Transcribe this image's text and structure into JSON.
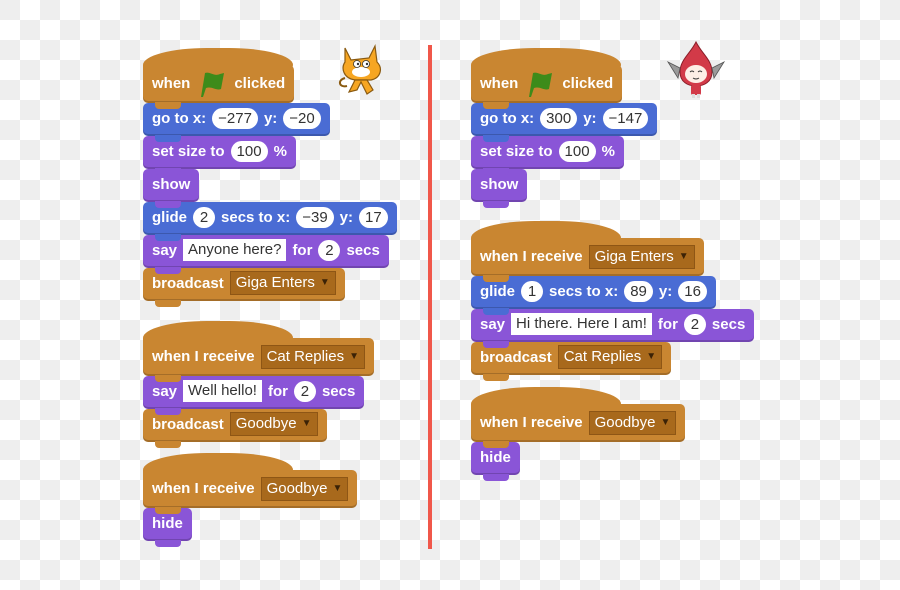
{
  "colors": {
    "events": "#c98631",
    "motion": "#4a6cd4",
    "looks": "#8a55d7",
    "divider": "#f0574a",
    "flag": "#3d8b1a"
  },
  "left": {
    "sprite": "cat-sprite",
    "scripts": [
      {
        "hat": {
          "prefix": "when",
          "icon": "green-flag-icon",
          "suffix": "clicked"
        },
        "blocks": [
          {
            "type": "goto",
            "label1": "go to x:",
            "x": "−277",
            "label2": "y:",
            "y": "−20"
          },
          {
            "type": "setsize",
            "label1": "set size to",
            "value": "100",
            "label2": "%"
          },
          {
            "type": "show",
            "label": "show"
          },
          {
            "type": "glide",
            "label1": "glide",
            "secs": "2",
            "label2": "secs to x:",
            "x": "−39",
            "label3": "y:",
            "y": "17"
          },
          {
            "type": "say",
            "label1": "say",
            "text": "Anyone here?",
            "label2": "for",
            "secs": "2",
            "label3": "secs"
          },
          {
            "type": "broadcast",
            "label": "broadcast",
            "message": "Giga Enters"
          }
        ]
      },
      {
        "hat": {
          "prefix": "when I receive",
          "message": "Cat Replies"
        },
        "blocks": [
          {
            "type": "say",
            "label1": "say",
            "text": "Well hello!",
            "label2": "for",
            "secs": "2",
            "label3": "secs"
          },
          {
            "type": "broadcast",
            "label": "broadcast",
            "message": "Goodbye"
          }
        ]
      },
      {
        "hat": {
          "prefix": "when I receive",
          "message": "Goodbye"
        },
        "blocks": [
          {
            "type": "hide",
            "label": "hide"
          }
        ]
      }
    ]
  },
  "right": {
    "sprite": "giga-sprite",
    "scripts": [
      {
        "hat": {
          "prefix": "when",
          "icon": "green-flag-icon",
          "suffix": "clicked"
        },
        "blocks": [
          {
            "type": "goto",
            "label1": "go to x:",
            "x": "300",
            "label2": "y:",
            "y": "−147"
          },
          {
            "type": "setsize",
            "label1": "set size to",
            "value": "100",
            "label2": "%"
          },
          {
            "type": "show",
            "label": "show"
          }
        ]
      },
      {
        "hat": {
          "prefix": "when I receive",
          "message": "Giga Enters"
        },
        "blocks": [
          {
            "type": "glide",
            "label1": "glide",
            "secs": "1",
            "label2": "secs to x:",
            "x": "89",
            "label3": "y:",
            "y": "16"
          },
          {
            "type": "say",
            "label1": "say",
            "text": "Hi there. Here I am!",
            "label2": "for",
            "secs": "2",
            "label3": "secs"
          },
          {
            "type": "broadcast",
            "label": "broadcast",
            "message": "Cat Replies"
          }
        ]
      },
      {
        "hat": {
          "prefix": "when I receive",
          "message": "Goodbye"
        },
        "blocks": [
          {
            "type": "hide",
            "label": "hide"
          }
        ]
      }
    ]
  }
}
